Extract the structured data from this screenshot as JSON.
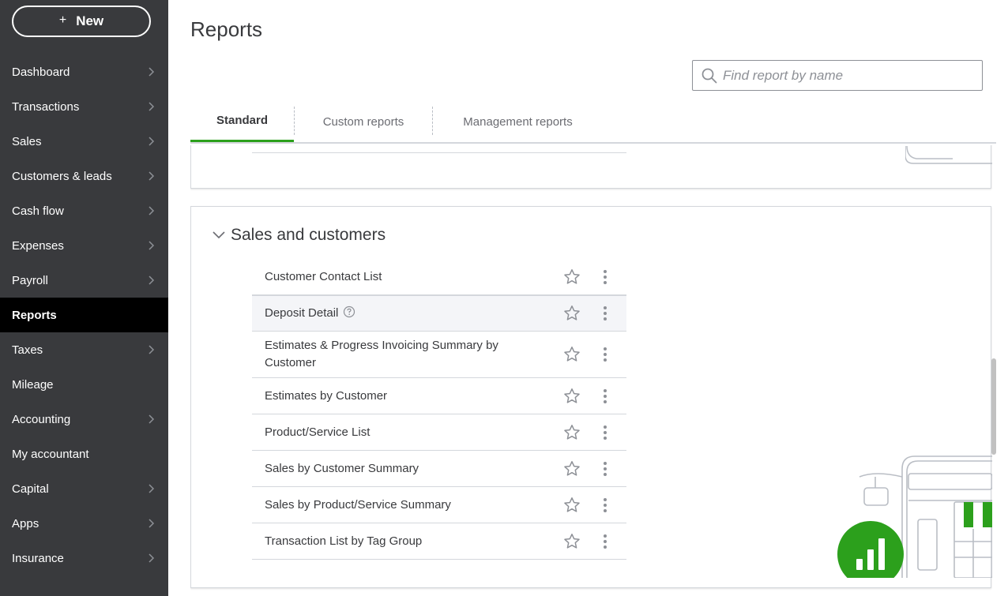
{
  "sidebar": {
    "new_button": "New",
    "items": [
      {
        "label": "Dashboard",
        "chevron": true,
        "active": false
      },
      {
        "label": "Transactions",
        "chevron": true,
        "active": false
      },
      {
        "label": "Sales",
        "chevron": true,
        "active": false
      },
      {
        "label": "Customers & leads",
        "chevron": true,
        "active": false
      },
      {
        "label": "Cash flow",
        "chevron": true,
        "active": false
      },
      {
        "label": "Expenses",
        "chevron": true,
        "active": false
      },
      {
        "label": "Payroll",
        "chevron": true,
        "active": false
      },
      {
        "label": "Reports",
        "chevron": false,
        "active": true
      },
      {
        "label": "Taxes",
        "chevron": true,
        "active": false
      },
      {
        "label": "Mileage",
        "chevron": false,
        "active": false
      },
      {
        "label": "Accounting",
        "chevron": true,
        "active": false
      },
      {
        "label": "My accountant",
        "chevron": false,
        "active": false
      },
      {
        "label": "Capital",
        "chevron": true,
        "active": false
      },
      {
        "label": "Apps",
        "chevron": true,
        "active": false
      },
      {
        "label": "Insurance",
        "chevron": true,
        "active": false
      }
    ]
  },
  "page": {
    "title": "Reports",
    "search_placeholder": "Find report by name"
  },
  "tabs": [
    {
      "label": "Standard",
      "active": true
    },
    {
      "label": "Custom reports",
      "active": false
    },
    {
      "label": "Management reports",
      "active": false
    }
  ],
  "section": {
    "title": "Sales and customers",
    "reports": [
      {
        "name": "Customer Contact List",
        "help": false,
        "highlight": false,
        "tall": false
      },
      {
        "name": "Deposit Detail",
        "help": true,
        "highlight": true,
        "tall": false
      },
      {
        "name": "Estimates & Progress Invoicing Summary by Customer",
        "help": false,
        "highlight": false,
        "tall": true
      },
      {
        "name": "Estimates by Customer",
        "help": false,
        "highlight": false,
        "tall": false
      },
      {
        "name": "Product/Service List",
        "help": false,
        "highlight": false,
        "tall": false
      },
      {
        "name": "Sales by Customer Summary",
        "help": false,
        "highlight": false,
        "tall": false
      },
      {
        "name": "Sales by Product/Service Summary",
        "help": false,
        "highlight": false,
        "tall": false
      },
      {
        "name": "Transaction List by Tag Group",
        "help": false,
        "highlight": false,
        "tall": false
      }
    ]
  },
  "icons": {
    "star": "star-icon",
    "more": "kebab-menu-icon",
    "help": "help-icon",
    "search": "search-icon",
    "nav_chevron": "chevron-right-icon",
    "section_chevron": "chevron-down-icon"
  },
  "colors": {
    "sidebar_bg": "#393a3d",
    "active_nav_bg": "#000000",
    "accent_green": "#2ca01c",
    "text": "#393a3d",
    "muted_text": "#6b6c72",
    "border": "#d4d7dc",
    "highlight_row": "#f4f5f8"
  }
}
